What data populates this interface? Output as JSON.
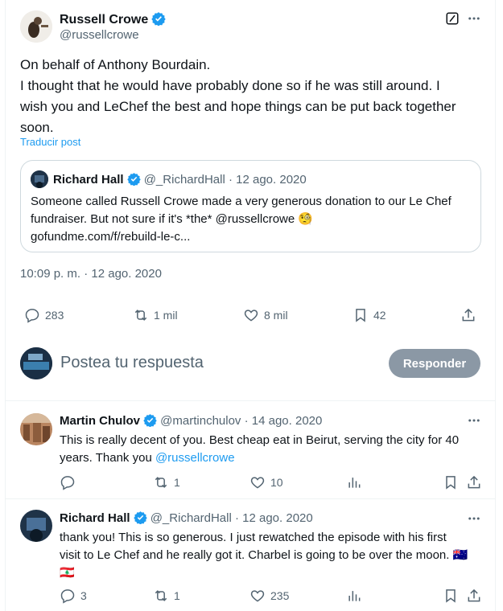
{
  "tweet": {
    "author_name": "Russell Crowe",
    "author_handle": "@russellcrowe",
    "lines": [
      "On behalf of Anthony Bourdain.",
      "I thought that he would have probably done so if he was still around. I",
      "wish you and LeChef the best and hope things can be put back together",
      "soon."
    ],
    "translate": "Traducir post",
    "timestamp": "10:09 p. m. · 12 ago. 2020",
    "stats": {
      "replies": "283",
      "reposts": "1 mil",
      "likes": "8 mil",
      "bookmarks": "42"
    }
  },
  "quote": {
    "author_name": "Richard Hall",
    "author_handle": "@_RichardHall",
    "date": "· 12 ago. 2020",
    "lines": [
      "Someone called Russell Crowe made a very generous donation to our Le Chef",
      "fundraiser. But not sure if it's *the* @russellcrowe 🧐",
      "gofundme.com/f/rebuild-le-c..."
    ]
  },
  "composer": {
    "placeholder": "Postea tu respuesta",
    "button": "Responder"
  },
  "replies": [
    {
      "author_name": "Martin Chulov",
      "author_handle": "@martinchulov",
      "date": "· 14 ago. 2020",
      "line1": "This is really decent of you. Best cheap eat in Beirut, serving the city for 40",
      "line2_text": "years. Thank you ",
      "line2_mention": "@russellcrowe",
      "stats": {
        "replies": "",
        "reposts": "1",
        "likes": "10"
      }
    },
    {
      "author_name": "Richard Hall",
      "author_handle": "@_RichardHall",
      "date": "· 12 ago. 2020",
      "line1": "thank you! This is so generous. I just rewatched the episode with his first",
      "line2_text": "visit to Le Chef and he really got it. Charbel is going to be over the moon. 🇦🇺",
      "line3_text": "🇱🇧",
      "stats": {
        "replies": "3",
        "reposts": "1",
        "likes": "235"
      }
    }
  ],
  "colors": {
    "accent": "#1d9bf0",
    "text": "#0f1419",
    "muted": "#536471",
    "border": "#cfd9de"
  }
}
